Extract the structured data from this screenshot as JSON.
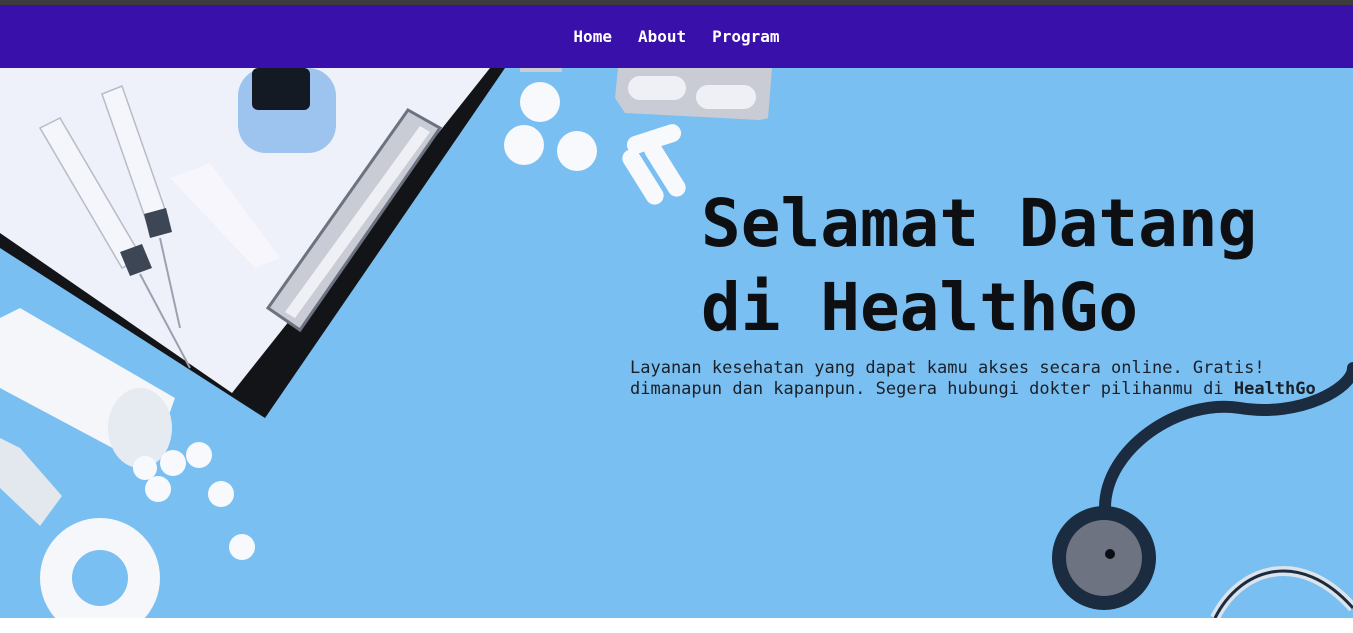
{
  "nav": {
    "items": [
      {
        "label": "Home"
      },
      {
        "label": "About"
      },
      {
        "label": "Program"
      }
    ]
  },
  "hero": {
    "title_line1": "Selamat Datang",
    "title_line2": "di HealthGo",
    "desc_line1": "Layanan kesehatan yang dapat kamu akses secara online. Gratis!",
    "desc_line2": "dimanapun dan kapanpun. Segera hubungi dokter pilihanmu di ",
    "desc_brand": "HealthGo"
  },
  "colors": {
    "navbar": "#3a10ab",
    "hero_background": "#79bff1",
    "title": "#0e0f12"
  },
  "icons": [
    "clipboard-image",
    "syringe-image",
    "pill-bottle-image",
    "stethoscope-image",
    "pills-image",
    "pulse-oximeter-image",
    "tape-roll-image"
  ]
}
